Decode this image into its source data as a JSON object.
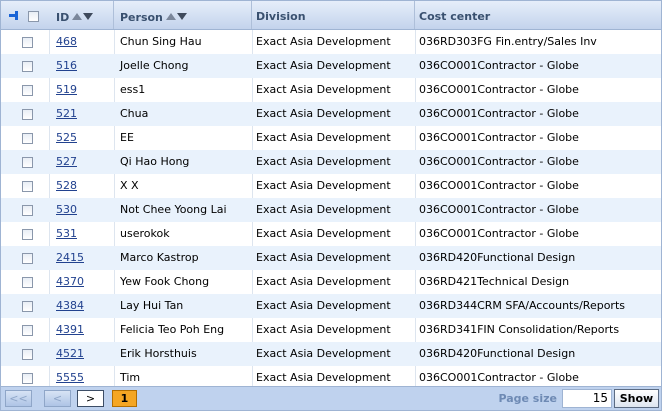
{
  "columns": {
    "id": "ID",
    "person": "Person",
    "division": "Division",
    "cost_center": "Cost center"
  },
  "rows": [
    {
      "id": "468",
      "person": "Chun Sing Hau",
      "division": "Exact Asia Development",
      "cost_center": "036RD303FG Fin.entry/Sales Inv"
    },
    {
      "id": "516",
      "person": "Joelle Chong",
      "division": "Exact Asia Development",
      "cost_center": "036CO001Contractor - Globe"
    },
    {
      "id": "519",
      "person": "ess1",
      "division": "Exact Asia Development",
      "cost_center": "036CO001Contractor - Globe"
    },
    {
      "id": "521",
      "person": "Chua",
      "division": "Exact Asia Development",
      "cost_center": "036CO001Contractor - Globe"
    },
    {
      "id": "525",
      "person": "EE",
      "division": "Exact Asia Development",
      "cost_center": "036CO001Contractor - Globe"
    },
    {
      "id": "527",
      "person": "Qi Hao Hong",
      "division": "Exact Asia Development",
      "cost_center": "036CO001Contractor - Globe"
    },
    {
      "id": "528",
      "person": "X X",
      "division": "Exact Asia Development",
      "cost_center": "036CO001Contractor - Globe"
    },
    {
      "id": "530",
      "person": "Not Chee Yoong Lai",
      "division": "Exact Asia Development",
      "cost_center": "036CO001Contractor - Globe"
    },
    {
      "id": "531",
      "person": "userokok",
      "division": "Exact Asia Development",
      "cost_center": "036CO001Contractor - Globe"
    },
    {
      "id": "2415",
      "person": "Marco Kastrop",
      "division": "Exact Asia Development",
      "cost_center": "036RD420Functional Design"
    },
    {
      "id": "4370",
      "person": "Yew Fook Chong",
      "division": "Exact Asia Development",
      "cost_center": "036RD421Technical Design"
    },
    {
      "id": "4384",
      "person": "Lay Hui Tan",
      "division": "Exact Asia Development",
      "cost_center": "036RD344CRM SFA/Accounts/Reports"
    },
    {
      "id": "4391",
      "person": "Felicia Teo Poh Eng",
      "division": "Exact Asia Development",
      "cost_center": "036RD341FIN Consolidation/Reports"
    },
    {
      "id": "4521",
      "person": "Erik Horsthuis",
      "division": "Exact Asia Development",
      "cost_center": "036RD420Functional Design"
    },
    {
      "id": "5555",
      "person": "Tim",
      "division": "Exact Asia Development",
      "cost_center": "036CO001Contractor - Globe"
    }
  ],
  "pager": {
    "first_label": "<<",
    "prev_label": "<",
    "next_label": ">",
    "current_page": "1",
    "page_size_label": "Page size",
    "page_size_value": "15",
    "show_label": "Show"
  },
  "colors": {
    "header_text": "#39506f",
    "link": "#22428f",
    "alt_row": "#e9f2fc",
    "pager_bg": "#bfd2ee",
    "current_page": "#f5a623"
  }
}
